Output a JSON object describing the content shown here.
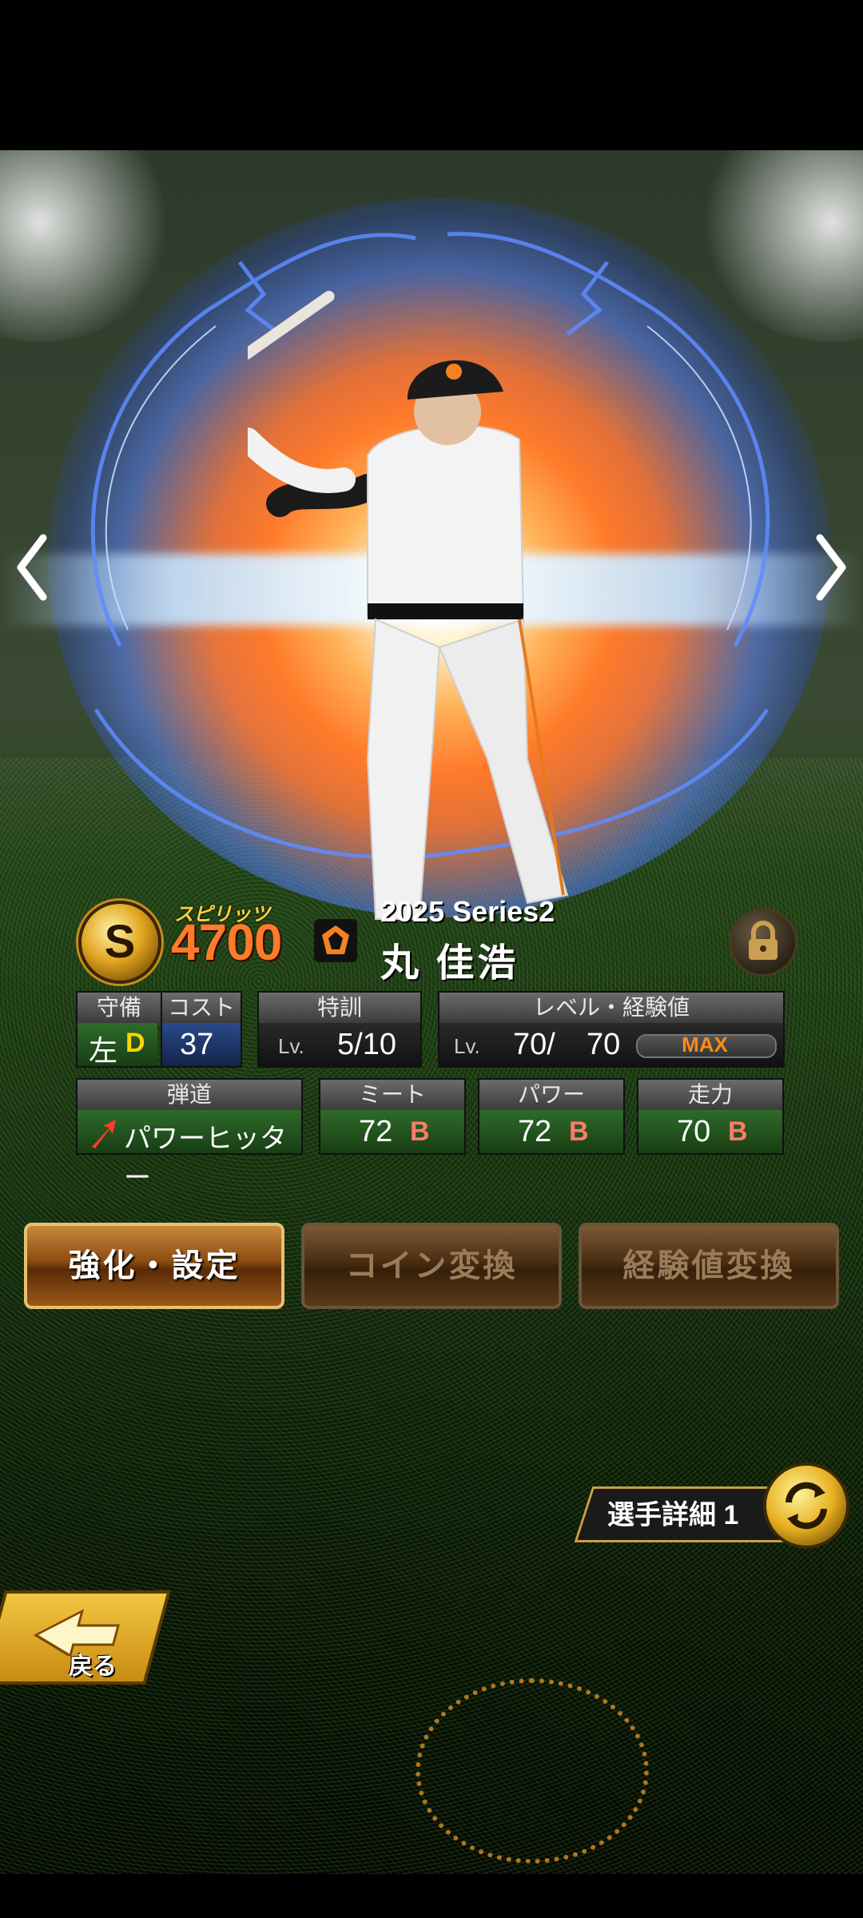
{
  "screen": "player-card-detail",
  "card": {
    "grade_icon": "S",
    "spirits_label": "スピリッツ",
    "spirits_value": "4700",
    "series": "2025 Series2",
    "player_name": "丸 佳浩"
  },
  "stats": {
    "defense": {
      "header": "守備",
      "hand": "左",
      "grade": "D"
    },
    "cost": {
      "header": "コスト",
      "value": "37"
    },
    "training": {
      "header": "特訓",
      "lv_prefix": "Lv.",
      "value": "5/10"
    },
    "level": {
      "header": "レベル・経験値",
      "lv_prefix": "Lv.",
      "current": "70/",
      "max": "70",
      "bar_label": "MAX",
      "bar_fill": 1.0
    },
    "trajectory": {
      "header": "弾道",
      "value": "パワーヒッター"
    },
    "meet": {
      "header": "ミート",
      "value": "72",
      "grade": "B"
    },
    "power": {
      "header": "パワー",
      "value": "72",
      "grade": "B"
    },
    "speed": {
      "header": "走力",
      "value": "70",
      "grade": "B"
    }
  },
  "buttons": {
    "enhance": "強化・設定",
    "coin_convert": "コイン変換",
    "exp_convert": "経験値変換"
  },
  "detail_button": "選手詳細 1",
  "back_button": "戻る",
  "icons": {
    "prev": "chevron-left-icon",
    "next": "chevron-right-icon",
    "lock": "lock-icon",
    "swap": "swap-arrows-icon",
    "back_arrow": "back-arrow-icon",
    "team_logo": "giants-logo"
  },
  "colors": {
    "grade_D": "#ffd400",
    "grade_B": "#ff7a6a",
    "max_label": "#ff8a1a",
    "spirits": "#ff7a2a"
  }
}
